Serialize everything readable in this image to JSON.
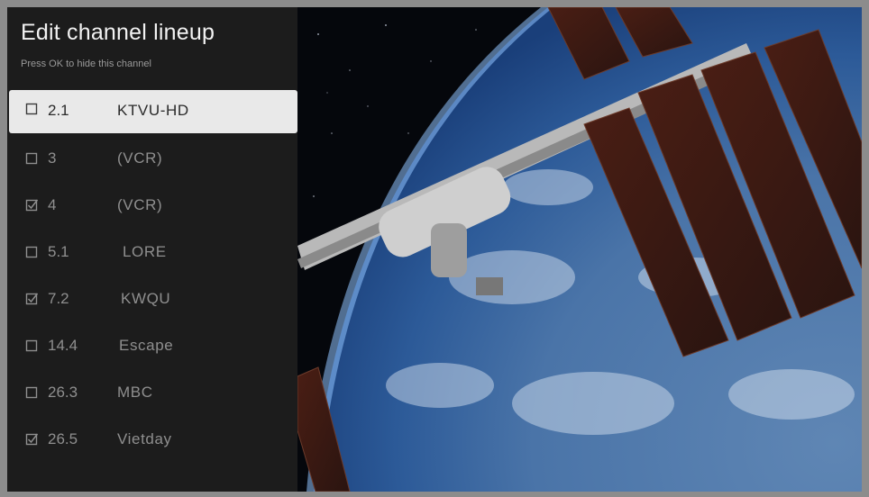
{
  "panel": {
    "title": "Edit channel lineup",
    "subtitle": "Press OK to hide this channel"
  },
  "channels": [
    {
      "number": "2.1",
      "name": "KTVU-HD",
      "checked": false,
      "selected": true
    },
    {
      "number": "3",
      "name": "(VCR)",
      "checked": false,
      "selected": false
    },
    {
      "number": "4",
      "name": "(VCR)",
      "checked": true,
      "selected": false
    },
    {
      "number": "5.1",
      "name": "LORE",
      "checked": false,
      "selected": false
    },
    {
      "number": "7.2",
      "name": "KWQU",
      "checked": true,
      "selected": false
    },
    {
      "number": "14.4",
      "name": "Escape",
      "checked": false,
      "selected": false
    },
    {
      "number": "26.3",
      "name": "MBC",
      "checked": false,
      "selected": false
    },
    {
      "number": "26.5",
      "name": "Vietday",
      "checked": true,
      "selected": false
    }
  ],
  "icons": {
    "unchecked": "checkbox-empty-icon",
    "checked": "checkbox-checked-icon"
  },
  "colors": {
    "panel_background": "#1c1c1c",
    "selected_row": "#e9e9e9",
    "title_text": "#f2f2f2",
    "row_text": "#8f8f8f"
  }
}
